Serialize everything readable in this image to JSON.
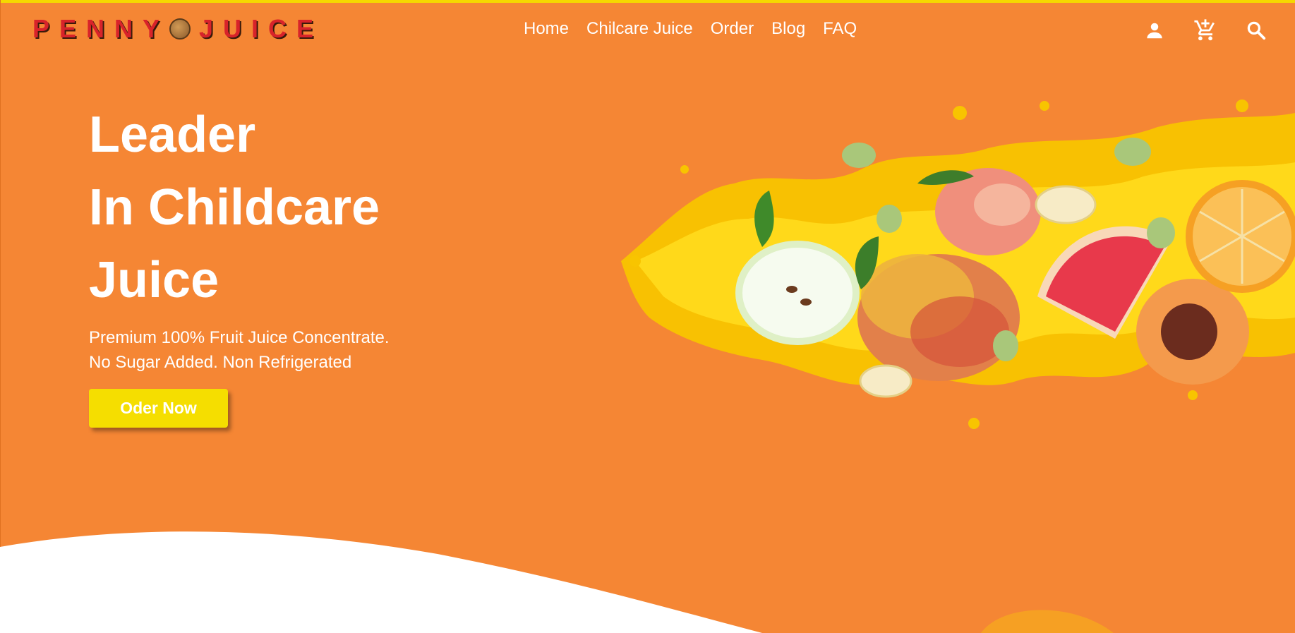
{
  "brand": {
    "name_left": "PENNY",
    "name_right": "JUICE",
    "logo_red": "#D8232A"
  },
  "nav": {
    "items": [
      "Home",
      "Chilcare Juice",
      "Order",
      "Blog",
      "FAQ"
    ]
  },
  "header_icons": [
    "account-icon",
    "add-to-cart-icon",
    "search-icon"
  ],
  "hero": {
    "title_lines": [
      "Leader",
      "In Childcare",
      "Juice"
    ],
    "subtitle_lines": [
      "Premium 100% Fruit Juice Concentrate.",
      "No Sugar Added. Non Refrigerated"
    ],
    "cta_label": "Oder Now"
  },
  "colors": {
    "background": "#F58634",
    "top_accent": "#F5D800",
    "cta": "#F5DE00",
    "text": "#FFFFFF"
  }
}
